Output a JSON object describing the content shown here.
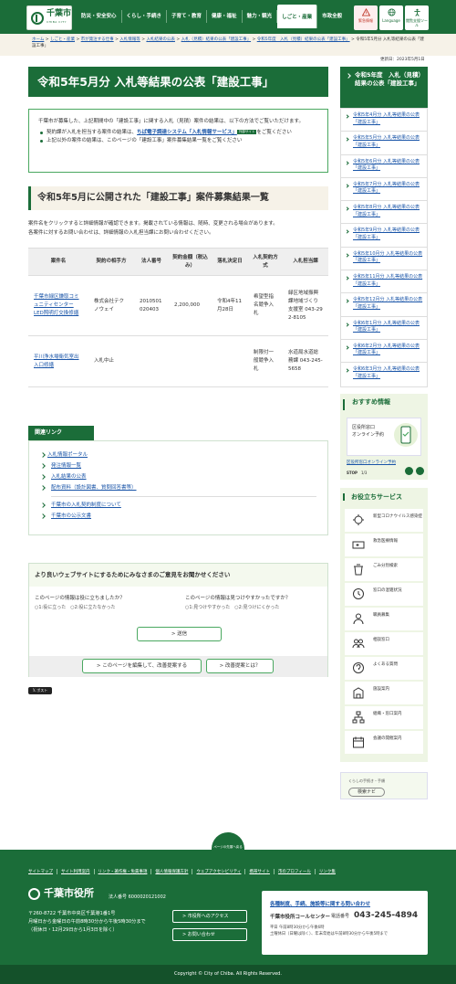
{
  "header": {
    "logo_name": "千葉市",
    "logo_sub": "CHIBA CITY",
    "nav": [
      "防災・安全安心",
      "くらし・手続き",
      "子育て・教育",
      "健康・福祉",
      "魅力・観光",
      "しごと・産業",
      "市政全般"
    ],
    "nav_active_index": 5,
    "quick": [
      "緊急情報",
      "Language",
      "閲覧支援ツール"
    ],
    "accent_color": "#1b6d39"
  },
  "breadcrumb": {
    "items": [
      "ホーム",
      "しごと・産業",
      "市が発注する仕事",
      "入札情報等",
      "入札結果の公表",
      "入札（見積）結果の公表「建設工事」",
      "令和5年度　入札（見積）結果の公表「建設工事」"
    ],
    "current": "令和5年5月分 入札等結果の公表「建設工事」"
  },
  "updated": "更新日：2023年5月1日",
  "page_title": "令和5年5月分 入札等結果の公表「建設工事」",
  "intro": {
    "text": "千葉市が募集した、上記期間中の「建設工事」に関する入札（見積）案件の結果は、以下の方法でご覧いただけます。",
    "bullet1_prefix": "契約課が入札を担当する案件の結果は、",
    "bullet1_link": "ちば電子調達システム「入札情報サービス」",
    "bullet1_badge": "外部サイト",
    "bullet1_suffix": "をご覧ください",
    "bullet2": "上記以外の案件の結果は、このページの「建設工事」案件募集結果一覧をご覧ください"
  },
  "section": {
    "title": "令和5年5月に公開された「建設工事」案件募集結果一覧",
    "note1": "案件名をクリックすると詳細情報が確認できます。掲載されている情報は、随時、変更される場合があります。",
    "note2": "各案件に対するお問い合わせは、詳細情報の入札担当課にお問い合わせください。"
  },
  "table": {
    "headers": [
      "案件名",
      "契約の相手方",
      "法人番号",
      "契約金額（税込み）",
      "落札決定日",
      "入札契約方式",
      "入札担当課"
    ],
    "rows": [
      {
        "name": "千葉市緑区鎌取コミュニティセンターLED照明灯交換修繕",
        "party": "株式会社テクノウェイ",
        "corp": "2010501020403",
        "amount": "2,200,000",
        "date": "令和4年11月28日",
        "method": "希望型指名競争入札",
        "dept": "緑区地域振興課地域づくり支援室 043-292-8105"
      },
      {
        "name": "平川浄水場衛気室出入口修繕",
        "party": "入札中止",
        "corp": "",
        "amount": "",
        "date": "",
        "method": "制限付一般競争入札",
        "dept": "水道局水道総務課 043-245-5658"
      }
    ]
  },
  "related": {
    "tab": "関連リンク",
    "top": "入札情報ポータル",
    "subs": [
      "発注情報一覧",
      "入札結果の公表",
      "配布資料（設計図書、質問回答書等）"
    ],
    "others": [
      "千葉市の入札契約制度について",
      "千葉市の公示文書"
    ]
  },
  "feedback": {
    "title": "より良いウェブサイトにするためにみなさまのご意見をお聞かせください",
    "q1": "このページの情報は役に立ちましたか？",
    "q1_opts": [
      "1:役に立った",
      "2:役に立たなかった"
    ],
    "q2": "このページの情報は見つけやすかったですか？",
    "q2_opts": [
      "1:見つけやすかった",
      "2:見つけにくかった"
    ],
    "send": "送信",
    "edit": "このページを編集して、改善提案する",
    "about": "改善提案とは？"
  },
  "post_button": "ポスト",
  "sidebar": {
    "title": "令和5年度　入札（見積）結果の公表「建設工事」",
    "items": [
      "令和5年4月分 入札等結果の公表「建設工事」",
      "令和5年5月分 入札等結果の公表「建設工事」",
      "令和5年6月分 入札等結果の公表「建設工事」",
      "令和5年7月分 入札等結果の公表「建設工事」",
      "令和5年8月分 入札等結果の公表「建設工事」",
      "令和5年9月分 入札等結果の公表「建設工事」",
      "令和5年10月分 入札等結果の公表「建設工事」",
      "令和5年11月分 入札等結果の公表「建設工事」",
      "令和5年12月分 入札等結果の公表「建設工事」",
      "令和6年1月分 入札等結果の公表「建設工事」",
      "令和6年2月分 入札等結果の公表「建設工事」",
      "令和6年3月分 入札等結果の公表「建設工事」"
    ]
  },
  "recommend": {
    "title": "おすすめ情報",
    "banner_l1": "区役所窓口",
    "banner_l2": "オンライン予約",
    "link": "区役所窓口オンライン予約",
    "stop": "STOP",
    "page": "1/3"
  },
  "services": {
    "title": "お役立ちサービス",
    "items": [
      "新型コロナウイルス感染症",
      "救急医療情報",
      "ごみ分別検索",
      "窓口の混雑状況",
      "職員募集",
      "相談窓口",
      "よくある質問",
      "施設案内",
      "組織・窓口案内",
      "会議の開催案内"
    ]
  },
  "navi": {
    "small": "くらしの手続き・手順",
    "button": "検索ナビ"
  },
  "page_top": "ページの先頭へ戻る",
  "footer": {
    "links": [
      "サイトマップ",
      "サイト利用案内",
      "リンク・著作権・免責事項",
      "個人情報保護方針",
      "ウェブアクセシビリティ",
      "携帯サイト",
      "市のプロフィール",
      "リンク集"
    ],
    "org": "千葉市役所",
    "corp_no": "法人番号 6000020121002",
    "addr1": "〒260-8722 千葉市中央区千葉港1番1号",
    "addr2": "月曜日から金曜日の午前8時30分から午後5時30分まで",
    "addr3": "（祝休日・12月29日から1月3日を除く）",
    "btn_access": "市役所へのアクセス",
    "btn_contact": "お問い合わせ",
    "cc_title": "各種制度、手続、施設等に関する問い合わせ",
    "cc_name": "千葉市役所コールセンター",
    "cc_tel_label": "電話番号",
    "cc_tel": "043-245-4894",
    "cc_hours1": "平日 午前8時30分から午後6時",
    "cc_hours2": "土曜休日（日曜は除く）、年末年始は午前8時30分から午後5時まで",
    "copyright": "Copyright © City of Chiba. All Rights Reserved."
  }
}
